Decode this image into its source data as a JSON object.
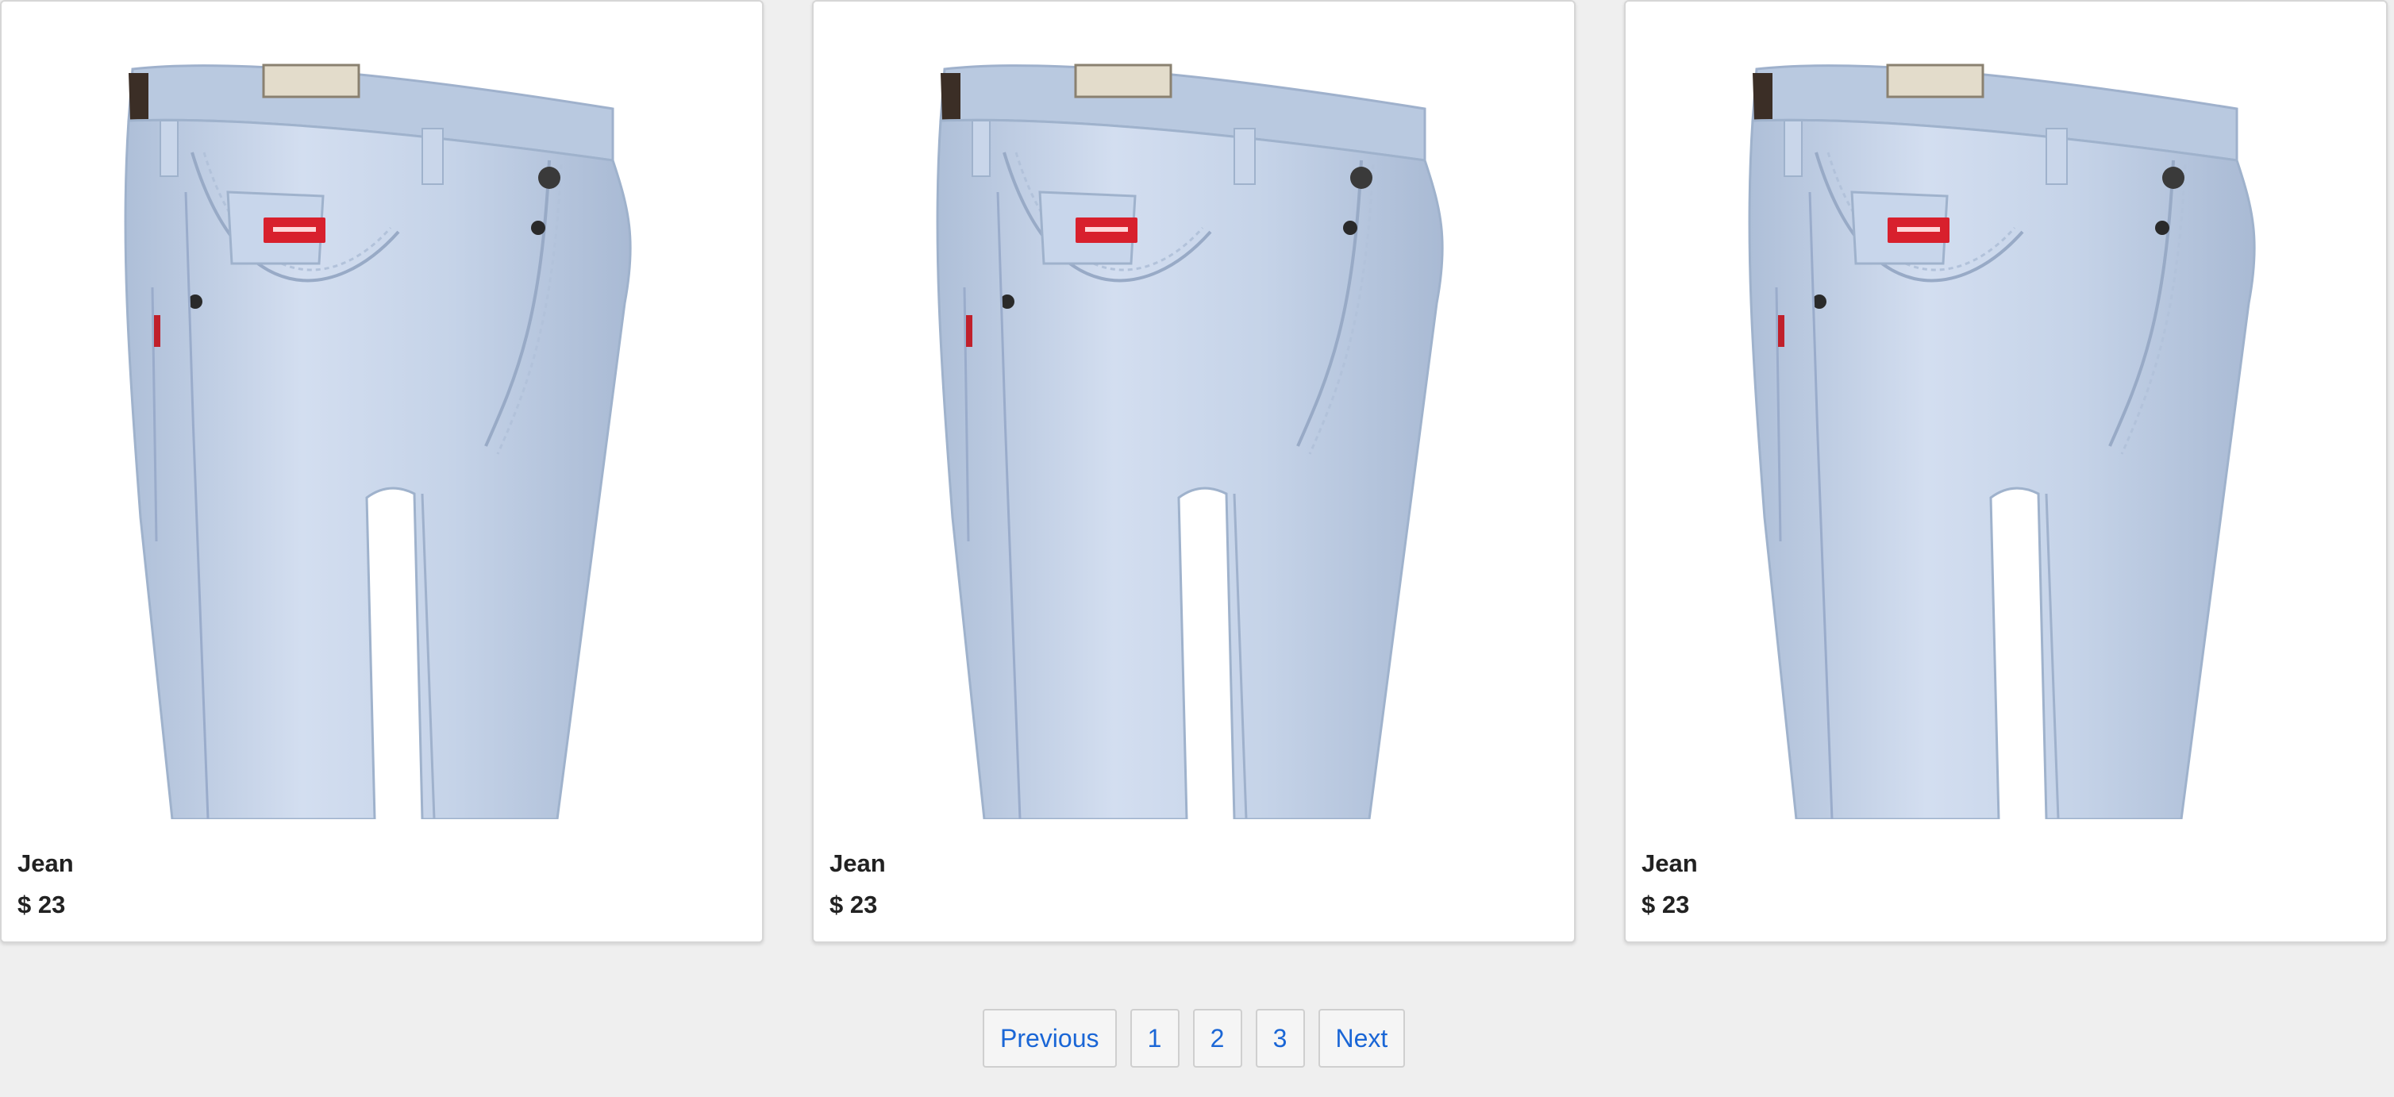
{
  "products": [
    {
      "name": "Jean",
      "price": "$ 23",
      "image": "light-wash-denim-jeans"
    },
    {
      "name": "Jean",
      "price": "$ 23",
      "image": "light-wash-denim-jeans"
    },
    {
      "name": "Jean",
      "price": "$ 23",
      "image": "light-wash-denim-jeans"
    }
  ],
  "pagination": {
    "previous_label": "Previous",
    "pages": [
      "1",
      "2",
      "3"
    ],
    "next_label": "Next"
  },
  "colors": {
    "background": "#efefef",
    "card": "#ffffff",
    "link": "#1a66d6",
    "denim": "#c4d3e6",
    "label_red": "#d8202d"
  }
}
